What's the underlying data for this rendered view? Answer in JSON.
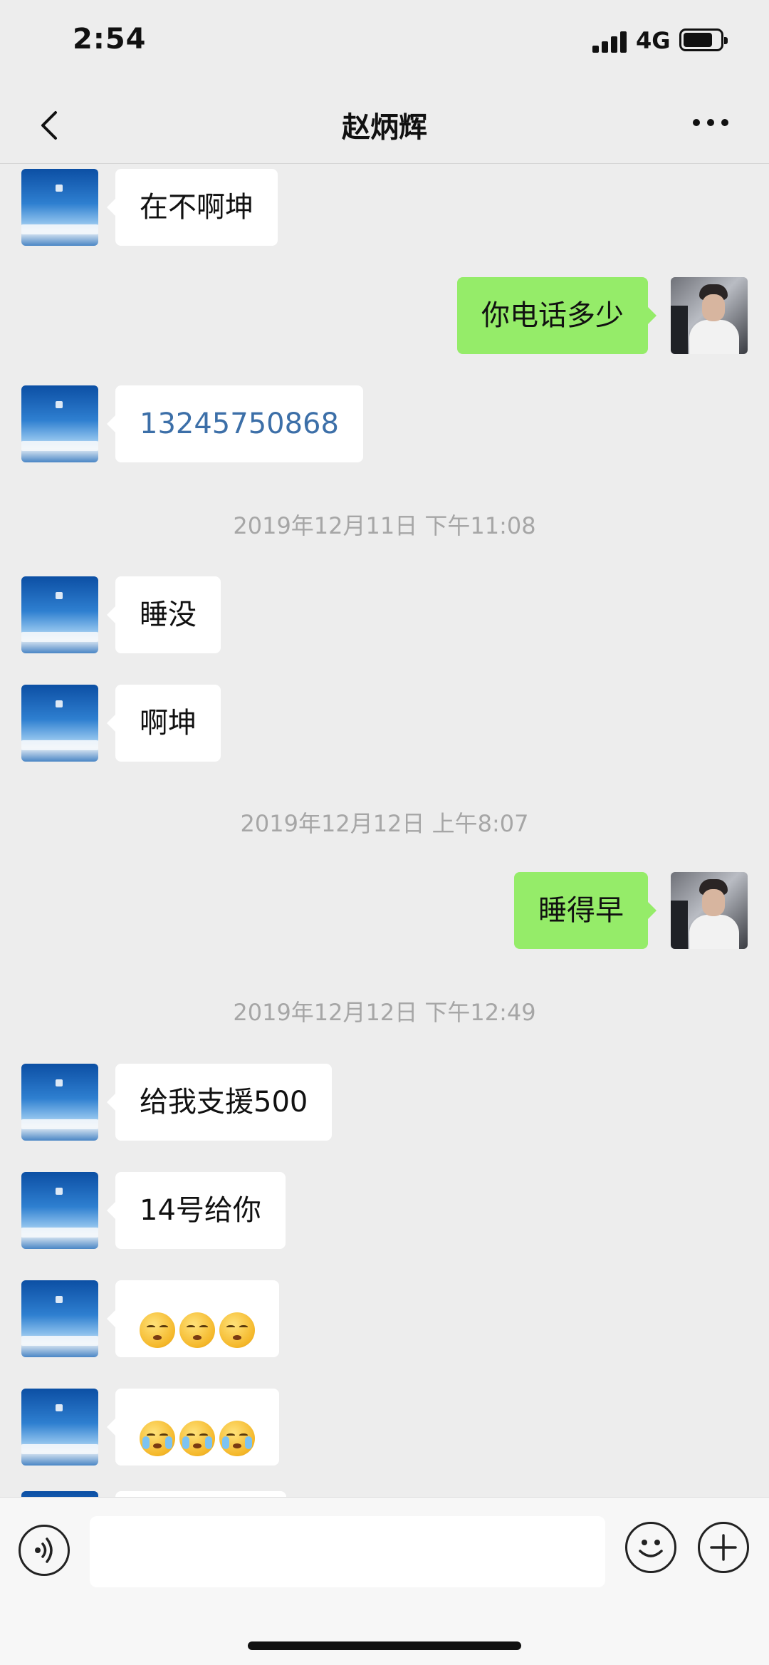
{
  "status_bar": {
    "time": "2:54",
    "network": "4G"
  },
  "header": {
    "title": "赵炳辉"
  },
  "messages": [
    {
      "type": "text",
      "sender": "other",
      "text": "在不啊坤"
    },
    {
      "type": "text",
      "sender": "me",
      "text": "你电话多少"
    },
    {
      "type": "phone",
      "sender": "other",
      "text": "13245750868"
    },
    {
      "type": "timestamp",
      "text": "2019年12月11日 下午11:08"
    },
    {
      "type": "text",
      "sender": "other",
      "text": "睡没"
    },
    {
      "type": "text",
      "sender": "other",
      "text": "啊坤"
    },
    {
      "type": "timestamp",
      "text": "2019年12月12日 上午8:07"
    },
    {
      "type": "text",
      "sender": "me",
      "text": "睡得早"
    },
    {
      "type": "timestamp",
      "text": "2019年12月12日 下午12:49"
    },
    {
      "type": "text",
      "sender": "other",
      "text": "给我支援500"
    },
    {
      "type": "text",
      "sender": "other",
      "text": "14号给你"
    },
    {
      "type": "emoji",
      "sender": "other",
      "emojis": [
        "kissing-face-emoji",
        "kissing-face-emoji",
        "kissing-face-emoji"
      ]
    },
    {
      "type": "emoji",
      "sender": "other",
      "emojis": [
        "loudly-crying-face-emoji",
        "loudly-crying-face-emoji",
        "loudly-crying-face-emoji"
      ]
    }
  ],
  "input": {
    "placeholder": ""
  },
  "colors": {
    "background": "#ededed",
    "my_bubble": "#95ec69",
    "other_bubble": "#ffffff",
    "phone_link": "#3c6fa8",
    "timestamp": "#a6a6a6"
  },
  "icons": {
    "back": "chevron-left-icon",
    "more": "more-dots-icon",
    "voice": "voice-icon",
    "emoji": "smiley-icon",
    "add": "plus-icon"
  }
}
